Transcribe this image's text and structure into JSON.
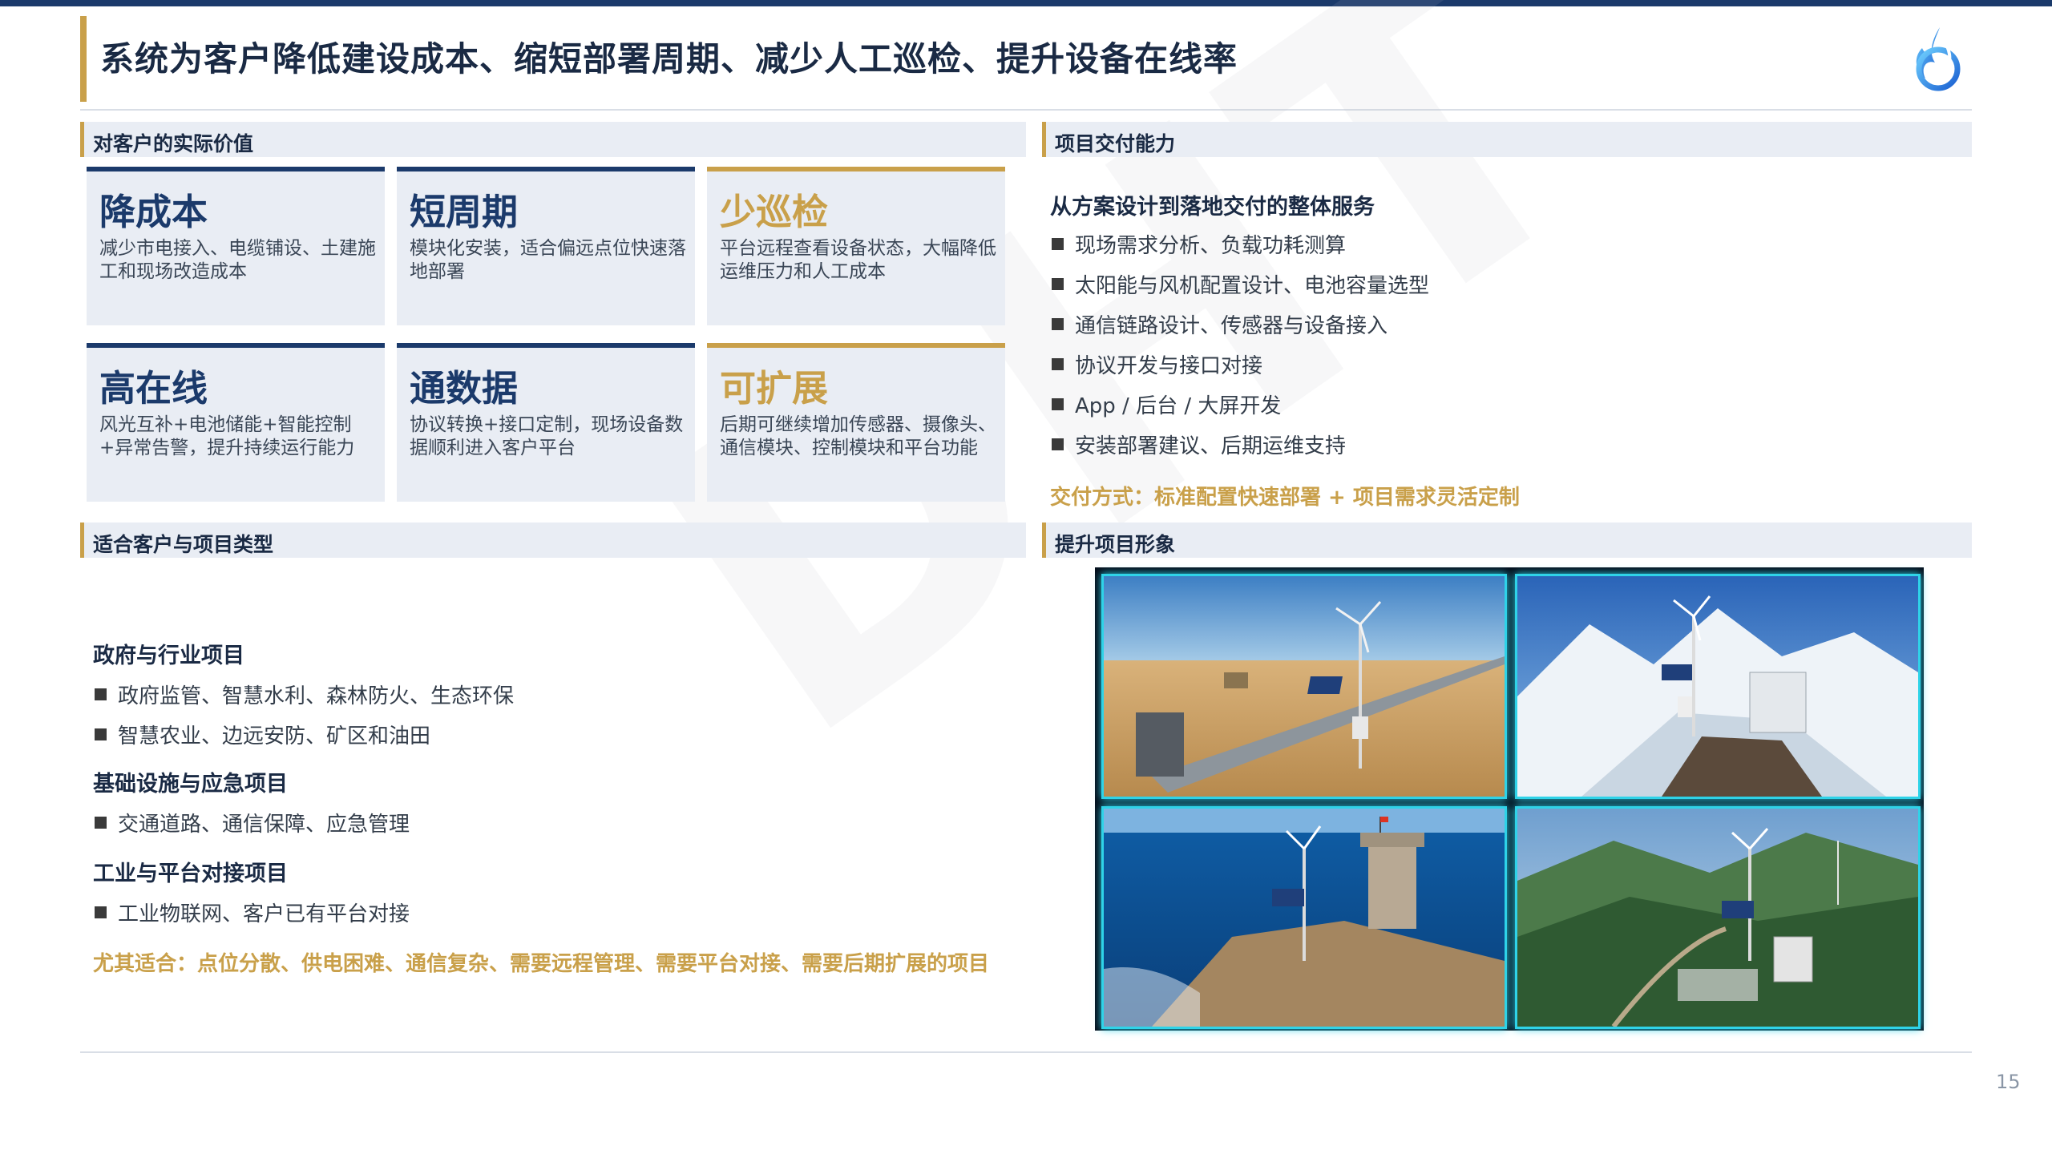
{
  "header": {
    "title": "系统为客户降低建设成本、缩短部署周期、减少人工巡检、提升设备在线率"
  },
  "value_section": {
    "heading": "对客户的实际价值",
    "cards": [
      {
        "title": "降成本",
        "desc": "减少市电接入、电缆铺设、土建施工和现场改造成本",
        "accent": "#1b3a6b"
      },
      {
        "title": "短周期",
        "desc": "模块化安装，适合偏远点位快速落地部署",
        "accent": "#1b3a6b"
      },
      {
        "title": "少巡检",
        "desc": "平台远程查看设备状态，大幅降低运维压力和人工成本",
        "accent": "#c9a04a"
      },
      {
        "title": "高在线",
        "desc": "风光互补+电池储能+智能控制+异常告警，提升持续运行能力",
        "accent": "#1b3a6b"
      },
      {
        "title": "通数据",
        "desc": "协议转换+接口定制，现场设备数据顺利进入客户平台",
        "accent": "#1b3a6b"
      },
      {
        "title": "可扩展",
        "desc": "后期可继续增加传感器、摄像头、通信模块、控制模块和平台功能",
        "accent": "#c9a04a"
      }
    ]
  },
  "delivery_section": {
    "heading": "项目交付能力",
    "subtitle": "从方案设计到落地交付的整体服务",
    "items": [
      "现场需求分析、负载功耗测算",
      "太阳能与风机配置设计、电池容量选型",
      "通信链路设计、传感器与设备接入",
      "协议开发与接口对接",
      "App / 后台 / 大屏开发",
      "安装部署建议、后期运维支持"
    ],
    "footer": "交付方式：标准配置快速部署 + 项目需求灵活定制"
  },
  "customer_section": {
    "heading": "适合客户与项目类型",
    "groups": [
      {
        "title": "政府与行业项目",
        "items": [
          "政府监管、智慧水利、森林防火、生态环保",
          "智慧农业、边远安防、矿区和油田"
        ]
      },
      {
        "title": "基础设施与应急项目",
        "items": [
          "交通道路、通信保障、应急管理"
        ]
      },
      {
        "title": "工业与平台对接项目",
        "items": [
          "工业物联网、客户已有平台对接"
        ]
      }
    ],
    "footer": "尤其适合：点位分散、供电困难、通信复杂、需要远程管理、需要平台对接、需要后期扩展的项目"
  },
  "image_section": {
    "heading": "提升项目形象"
  },
  "watermark": "DHT",
  "page_number": "15",
  "colors": {
    "navy": "#1b3a6b",
    "gold": "#c9a04a",
    "panel": "#e9edf4",
    "frame_glow": "#2fd3e8"
  }
}
